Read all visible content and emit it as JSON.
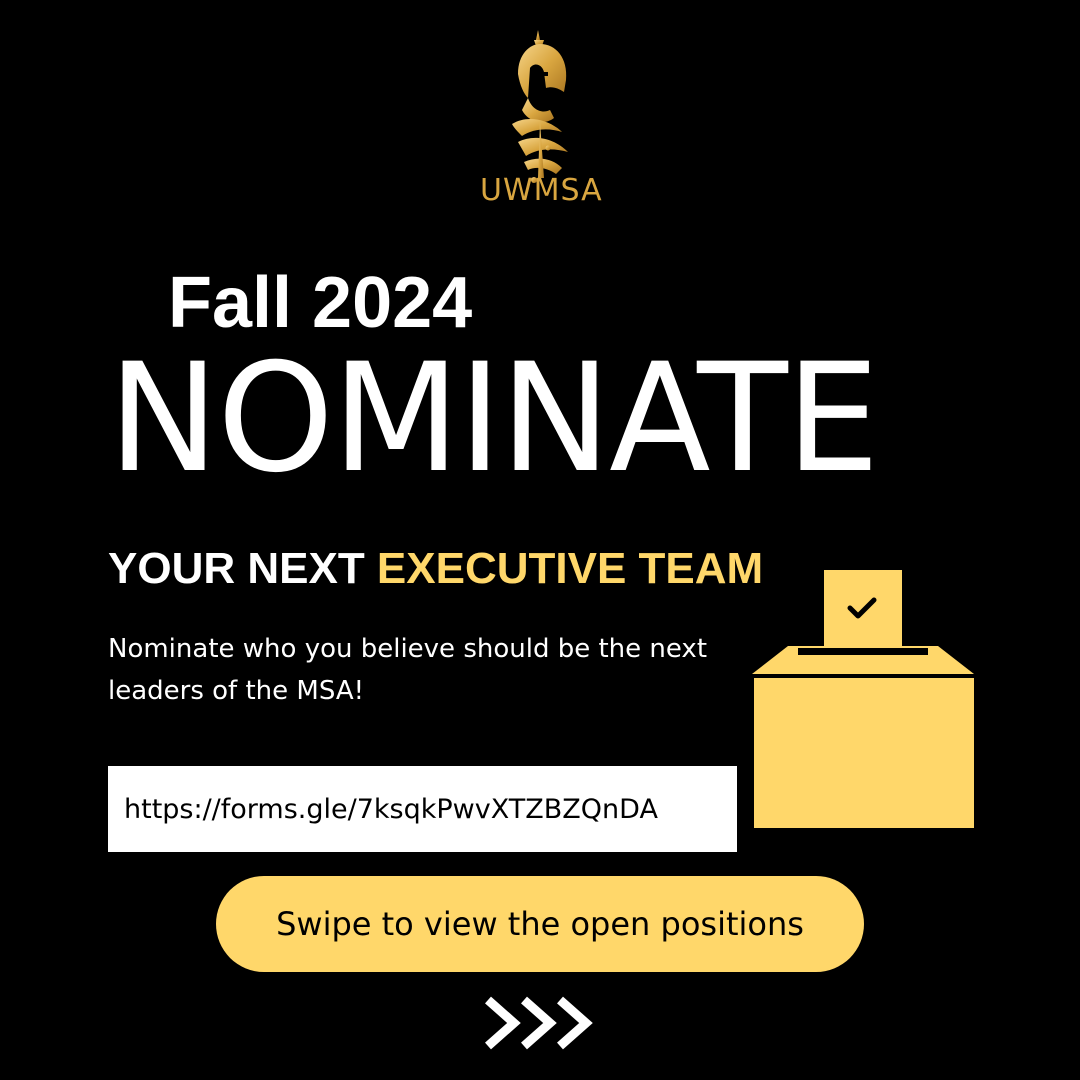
{
  "logo": {
    "icon": "knight-helmet-calligraphy-logo",
    "text": "UWMSA",
    "color": "#D9A640"
  },
  "kicker": "Fall 2024",
  "headline": "NOMINATE",
  "subheading": {
    "part1": "YOUR NEXT ",
    "part2": "EXECUTIVE TEAM"
  },
  "description": "Nominate who you believe should be the next leaders of the MSA!",
  "link": {
    "url": "https://forms.gle/7ksqkPwvXTZBZQnDA"
  },
  "illustration": {
    "icon": "ballot-box-icon"
  },
  "cta": {
    "label": "Swipe to view the open positions",
    "icon": "triple-chevron-right-icon"
  },
  "colors": {
    "background": "#000000",
    "accent": "#FFD76A",
    "text": "#FFFFFF",
    "logo_gold": "#D9A640"
  }
}
